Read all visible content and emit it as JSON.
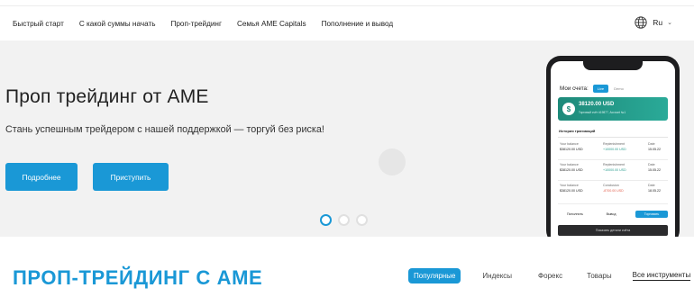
{
  "nav": {
    "links": [
      "Быстрый старт",
      "С какой суммы начать",
      "Проп-трейдинг",
      "Семья AME Capitals",
      "Пополнение и вывод"
    ],
    "language": "Ru"
  },
  "hero": {
    "title": "Проп трейдинг от AME",
    "subtitle": "Стань успешным трейдером с нашей поддержкой — торгуй без риска!",
    "btn_more": "Подробнее",
    "btn_start": "Приступить",
    "slides_count": 3,
    "active_slide": 1
  },
  "phone": {
    "accounts_label": "Мои счета:",
    "account_tab_active": "Live",
    "account_tab_other": "Demo",
    "balance": "38120.00 USD",
    "balance_sub": "Торговый счёт #19877, Account №1",
    "history_title": "История транзакций",
    "transactions": [
      {
        "c1": "Your balance",
        "v1": "$38120.00 USD",
        "c2": "Replenishment",
        "v2": "+10000.00 USD",
        "v2_color": "green",
        "c3": "Date",
        "v3": "15.05.22"
      },
      {
        "c1": "Your balance",
        "v1": "$38120.00 USD",
        "c2": "Replenishment",
        "v2": "+10000.00 USD",
        "v2_color": "green",
        "c3": "Date",
        "v3": "15.05.22"
      },
      {
        "c1": "Your balance",
        "v1": "$38120.00 USD",
        "c2": "Conclusion",
        "v2": "-8700.00 USD",
        "v2_color": "red",
        "c3": "Date",
        "v3": "18.05.22"
      }
    ],
    "btn_topup": "Пополнить",
    "btn_withdraw": "Вывод",
    "btn_trade": "Торговать",
    "dark_label": "Показать детали счёта"
  },
  "section": {
    "title": "ПРОП-ТРЕЙДИНГ С AME",
    "tabs": [
      "Популярные",
      "Индексы",
      "Форекс",
      "Товары"
    ],
    "all_link": "Все инструменты"
  }
}
